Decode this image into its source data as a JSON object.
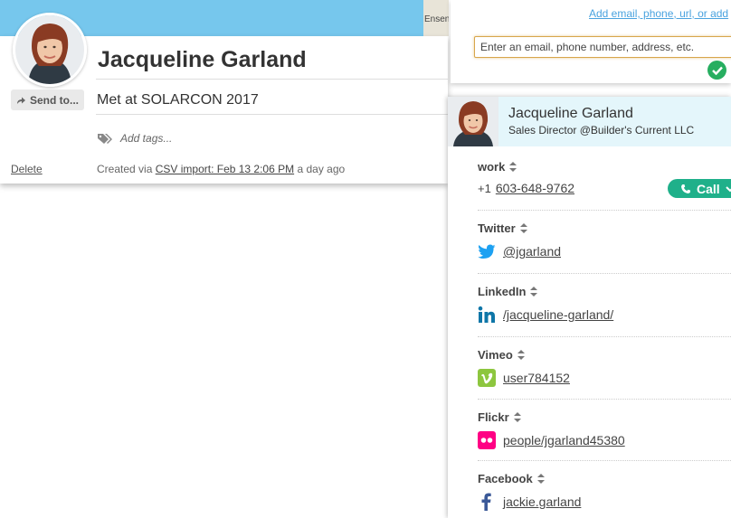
{
  "contact": {
    "name": "Jacqueline Garland",
    "note": "Met at SOLARCON 2017",
    "send_label": "Send to...",
    "tags_placeholder": "Add tags...",
    "delete_label": "Delete",
    "created_prefix": "Created via",
    "created_link": "CSV import: Feb 13 2:06 PM",
    "created_suffix": "a day ago"
  },
  "map": {
    "label": "Ensen"
  },
  "add_panel": {
    "link": "Add email, phone, url, or add",
    "input_placeholder": "Enter an email, phone number, address, etc."
  },
  "profile": {
    "name": "Jacqueline Garland",
    "title": "Sales Director @Builder's Current LLC",
    "call_label": "Call",
    "entries": [
      {
        "label": "work",
        "prefix": "+1",
        "value": "603-648-9762",
        "icon": "phone"
      },
      {
        "label": "Twitter",
        "value": "@jgarland",
        "icon": "twitter-icon"
      },
      {
        "label": "LinkedIn",
        "value": "/jacqueline-garland/",
        "icon": "linkedin-icon"
      },
      {
        "label": "Vimeo",
        "value": "user784152",
        "icon": "vimeo-icon"
      },
      {
        "label": "Flickr",
        "value": "people/jgarland45380",
        "icon": "flickr-icon"
      },
      {
        "label": "Facebook",
        "value": "jackie.garland",
        "icon": "facebook-icon"
      }
    ]
  },
  "colors": {
    "header_blue": "#76c7ed",
    "call_green": "#1fb08a",
    "check_green": "#27ae60",
    "twitter": "#1da1f2",
    "linkedin": "#0e76a8",
    "vimeo": "#8dc63f",
    "flickr": "#ff0084",
    "facebook": "#3b5998"
  }
}
